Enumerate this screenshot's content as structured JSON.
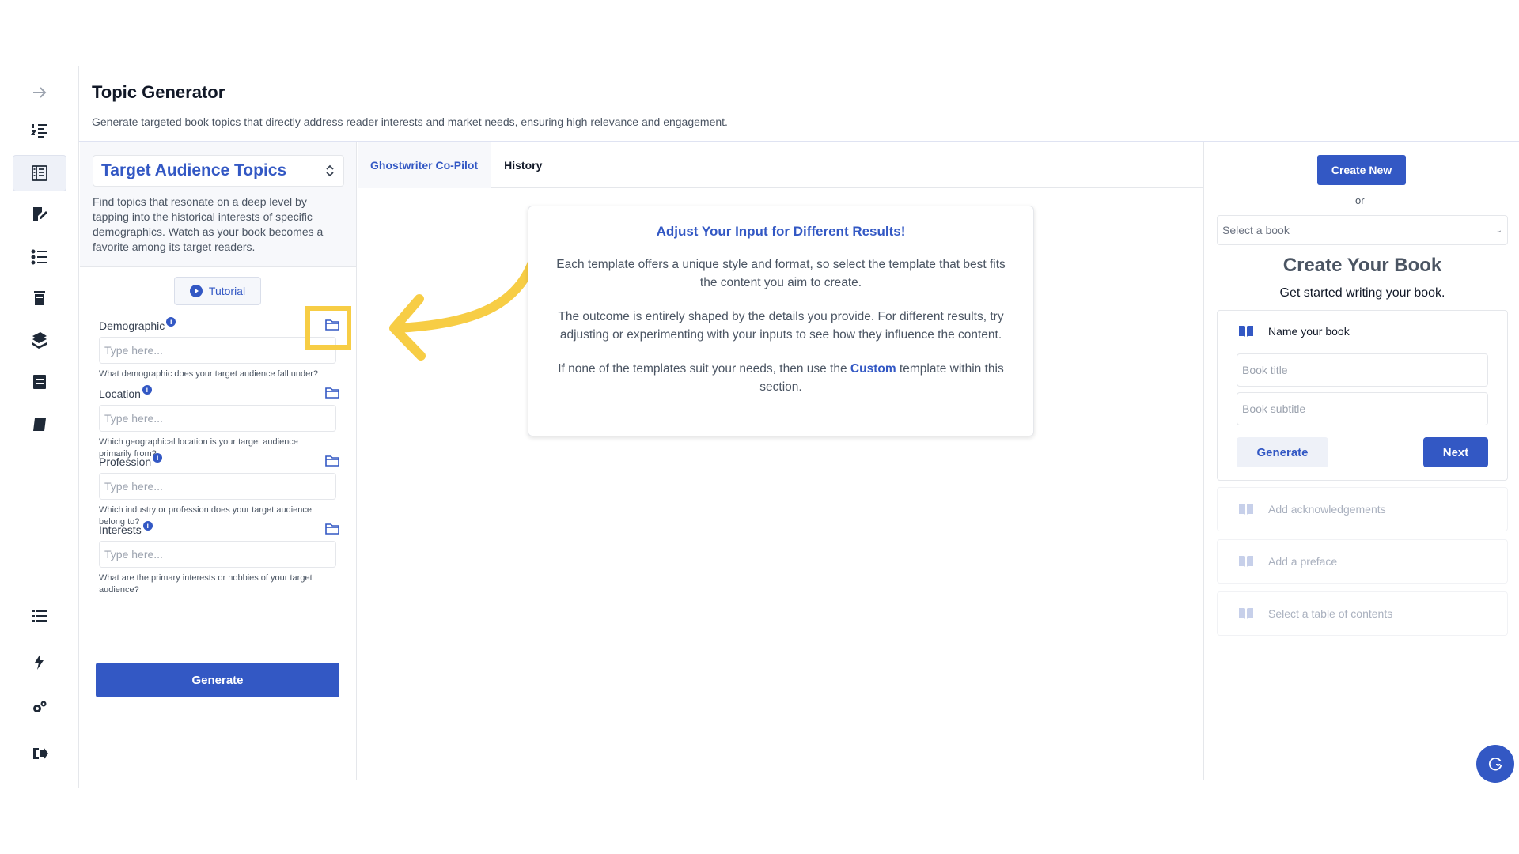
{
  "header": {
    "title": "Topic Generator",
    "subtitle": "Generate targeted book topics that directly address reader interests and market needs, ensuring high relevance and engagement."
  },
  "sidebar": {
    "items": [
      {
        "icon": "arrow-right-icon"
      },
      {
        "icon": "numbered-list-icon"
      },
      {
        "icon": "topic-list-icon",
        "active": true
      },
      {
        "icon": "edit-document-icon"
      },
      {
        "icon": "checklist-icon"
      },
      {
        "icon": "book-stack-icon"
      },
      {
        "icon": "books-icon"
      },
      {
        "icon": "archive-icon"
      },
      {
        "icon": "notebook-icon"
      },
      {
        "icon": "list-icon"
      },
      {
        "icon": "lightning-icon"
      },
      {
        "icon": "settings-gears-icon"
      },
      {
        "icon": "logout-icon"
      }
    ]
  },
  "left_panel": {
    "selector_label": "Target Audience Topics",
    "description": "Find topics that resonate on a deep level by tapping into the historical interests of specific demographics. Watch as your book becomes a favorite among its target readers.",
    "tutorial_label": "Tutorial",
    "fields": [
      {
        "label": "Demographic",
        "placeholder": "Type here...",
        "help": "What demographic does your target audience fall under?"
      },
      {
        "label": "Location",
        "placeholder": "Type here...",
        "help": "Which geographical location is your target audience primarily from?"
      },
      {
        "label": "Profession",
        "placeholder": "Type here...",
        "help": "Which industry or profession does your target audience belong to?"
      },
      {
        "label": "Interests",
        "placeholder": "Type here...",
        "help": "What are the primary interests or hobbies of your target audience?"
      }
    ],
    "info_symbol": "i",
    "generate_label": "Generate"
  },
  "tabs": [
    {
      "label": "Ghostwriter Co-Pilot",
      "active": true
    },
    {
      "label": "History",
      "active": false
    }
  ],
  "info_card": {
    "title": "Adjust Your Input for Different Results!",
    "para1": "Each template offers a unique style and format, so select the template that best fits the content you aim to create.",
    "para2": "The outcome is entirely shaped by the details you provide. For different results, try adjusting or experimenting with your inputs to see how they influence the content.",
    "para3_before": "If none of the templates suit your needs, then use the ",
    "para3_link": "Custom",
    "para3_after": " template within this section."
  },
  "right_panel": {
    "create_new_label": "Create New",
    "or_text": "or",
    "book_select_value": "Select a book",
    "title": "Create Your Book",
    "subtitle": "Get started writing your book.",
    "name_step_label": "Name your book",
    "book_title_placeholder": "Book title",
    "book_subtitle_placeholder": "Book subtitle",
    "generate_label": "Generate",
    "next_label": "Next",
    "steps": [
      {
        "label": "Add acknowledgements"
      },
      {
        "label": "Add a preface"
      },
      {
        "label": "Select a table of contents"
      }
    ]
  },
  "colors": {
    "accent": "#3358c4",
    "highlight": "#f7cd45"
  }
}
